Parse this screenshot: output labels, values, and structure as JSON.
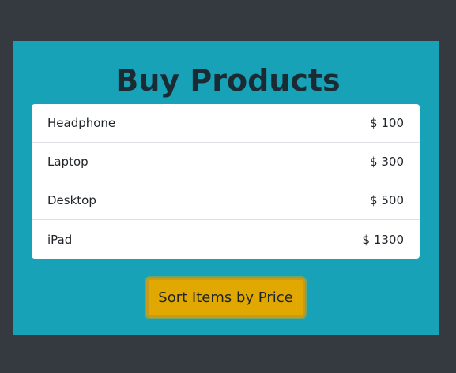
{
  "page": {
    "title": "Buy Products",
    "colors": {
      "background": "#343a40",
      "panel": "#17a2b8",
      "button": "#e0a800",
      "title_text": "#1b2b33"
    }
  },
  "products": [
    {
      "name": "Headphone",
      "price": "$ 100"
    },
    {
      "name": "Laptop",
      "price": "$ 300"
    },
    {
      "name": "Desktop",
      "price": "$ 500"
    },
    {
      "name": "iPad",
      "price": "$ 1300"
    }
  ],
  "actions": {
    "sort_label": "Sort Items by Price"
  }
}
